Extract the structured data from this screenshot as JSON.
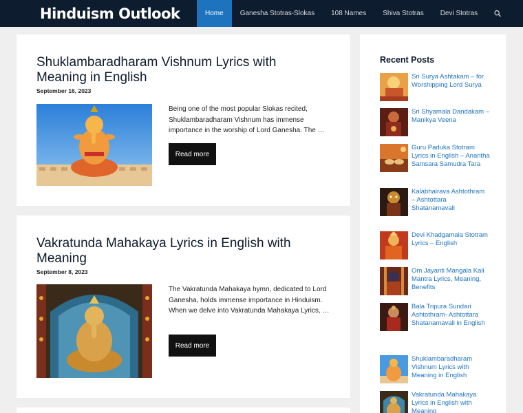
{
  "site": {
    "logo_text": "Hinduism Outlook"
  },
  "nav": {
    "items": [
      {
        "label": "Home"
      },
      {
        "label": "Ganesha Stotras-Slokas"
      },
      {
        "label": "108 Names"
      },
      {
        "label": "Shiva Stotras"
      },
      {
        "label": "Devi Stotras"
      }
    ],
    "search_icon": "search-icon"
  },
  "posts": [
    {
      "title": "Shuklambaradharam Vishnum Lyrics with Meaning in English",
      "date": "September 16, 2023",
      "excerpt": "Being one of the most popular Slokas recited, Shuklambaradharam Vishnum has immense importance in the worship of Lord Ganesha. The …",
      "button": "Read more"
    },
    {
      "title": "Vakratunda Mahakaya Lyrics in English with Meaning",
      "date": "September 8, 2023",
      "excerpt": "The Vakratunda Mahakaya hymn, dedicated to Lord Ganesha, holds immense importance in Hinduism. When we delve into Vakratunda Mahakaya Lyrics, …",
      "button": "Read more"
    }
  ],
  "sidebar": {
    "title": "Recent Posts",
    "items": [
      {
        "label": "Sri Surya Ashtakam – for Worshipping Lord Surya"
      },
      {
        "label": "Sri Shyamala Dandakam – Manikya Veena"
      },
      {
        "label": "Guru Paduka Stotram Lyrics in English – Anantha Samsara Samudra Tara"
      },
      {
        "label": "Kalabhairava Ashtothram – Ashtottara Shatanamavali"
      },
      {
        "label": "Devi Khadgamala Stotram Lyrics – English"
      },
      {
        "label": "Om Jayanti Mangala Kali Mantra Lyrics, Meaning, Benefits"
      },
      {
        "label": "Bala Tripura Sundari Ashtothram- Ashtottara Shatanamavali in English"
      },
      {
        "label": "Shuklambaradharam Vishnum Lyrics with Meaning in English"
      },
      {
        "label": "Vakratunda Mahakaya Lyrics in English with Meaning"
      }
    ]
  },
  "colors": {
    "header_bg": "#0d1c2e",
    "accent": "#1e73be",
    "button_bg": "#111111",
    "page_bg": "#efefef"
  }
}
